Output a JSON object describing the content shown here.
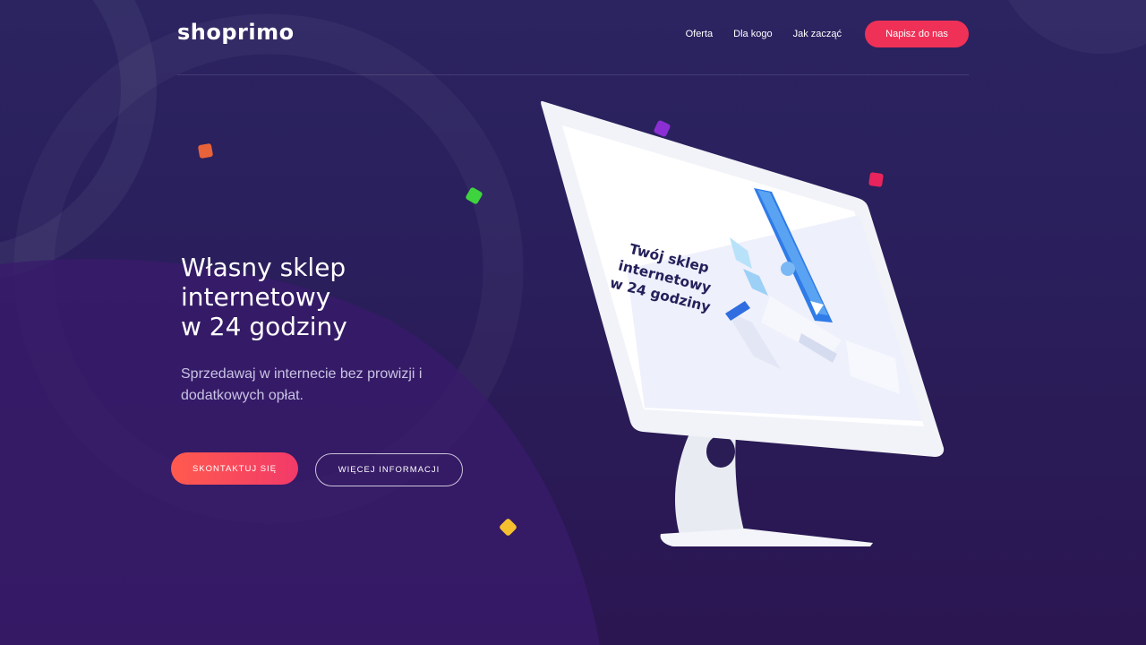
{
  "brand": {
    "logo": "shoprimo"
  },
  "nav": {
    "items": [
      {
        "label": "Oferta"
      },
      {
        "label": "Dla kogo"
      },
      {
        "label": "Jak zacząć"
      }
    ],
    "cta_label": "Napisz do nas"
  },
  "hero": {
    "title": "Własny sklep\ninternetowy\nw 24 godziny",
    "subtitle": "Sprzedawaj w internecie bez prowizji i dodatkowych opłat.",
    "primary_button": "Skontaktuj się",
    "secondary_button": "Więcej informacji"
  },
  "monitor_screen": {
    "headline": "Twój sklep\ninternetowy\nw 24 godziny"
  },
  "colors": {
    "background": "#2a1f5c",
    "accent": "#ef3157",
    "button_gradient_start": "#ff5a4e",
    "button_gradient_end": "#f23a69",
    "confetti": [
      "#e8623a",
      "#3ed43e",
      "#8b2fd4",
      "#e8245c",
      "#f5c030"
    ]
  }
}
